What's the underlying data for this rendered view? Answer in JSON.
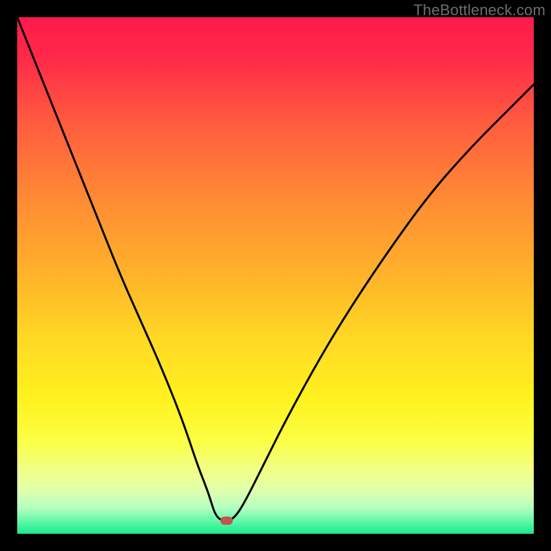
{
  "watermark": "TheBottleneck.com",
  "marker": {
    "color": "#c0574e",
    "x_frac": 0.405,
    "y_frac": 0.975
  },
  "gradient_stops": [
    {
      "offset": "0%",
      "color": "#ff1a4b"
    },
    {
      "offset": "8%",
      "color": "#ff2a49"
    },
    {
      "offset": "20%",
      "color": "#ff5a3f"
    },
    {
      "offset": "35%",
      "color": "#ff8a34"
    },
    {
      "offset": "50%",
      "color": "#ffb32a"
    },
    {
      "offset": "62%",
      "color": "#ffd824"
    },
    {
      "offset": "74%",
      "color": "#fff21f"
    },
    {
      "offset": "82%",
      "color": "#fbff45"
    },
    {
      "offset": "88%",
      "color": "#f1ff8a"
    },
    {
      "offset": "92%",
      "color": "#dcffb0"
    },
    {
      "offset": "95%",
      "color": "#b4ffbf"
    },
    {
      "offset": "97.5%",
      "color": "#63f9a8"
    },
    {
      "offset": "100%",
      "color": "#19e88f"
    }
  ],
  "chart_data": {
    "type": "line",
    "title": "",
    "xlabel": "",
    "ylabel": "",
    "xlim": [
      0,
      100
    ],
    "ylim": [
      0,
      100
    ],
    "note": "Bottleneck percentage curve. x is component-ratio position (0..100), y is bottleneck % (0 = perfect match, 100 = full bottleneck). Background heatmap: green at bottom (no bottleneck) through yellow/orange to red at top (severe bottleneck). Values traced from pixels.",
    "series": [
      {
        "name": "bottleneck-curve",
        "x": [
          0,
          4,
          8,
          12,
          16,
          20,
          24,
          28,
          32,
          35,
          37,
          38.5,
          40.5,
          42,
          44,
          48,
          52,
          58,
          64,
          72,
          80,
          88,
          96,
          100
        ],
        "y": [
          100,
          90,
          80,
          70,
          60,
          50,
          41,
          32,
          22,
          13,
          8,
          3,
          2.5,
          3,
          6,
          14,
          22,
          33,
          43,
          55,
          66,
          75,
          83,
          87
        ]
      }
    ],
    "marker_point": {
      "x": 40.5,
      "y": 2.5
    }
  }
}
